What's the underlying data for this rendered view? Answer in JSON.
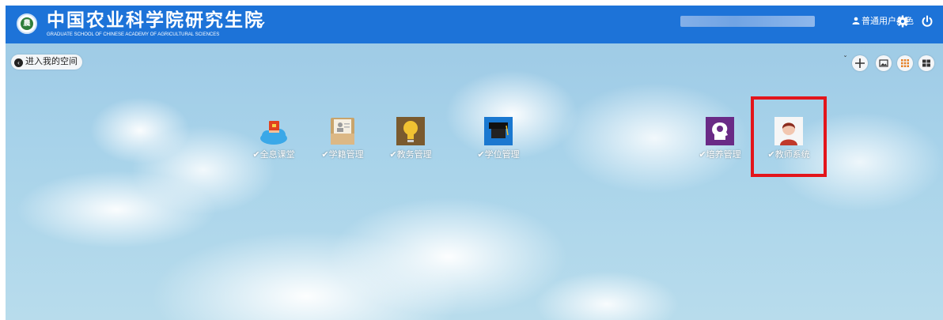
{
  "header": {
    "title_cn": "中国农业科学院研究生院",
    "title_en": "GRADUATE SCHOOL OF CHINESE ACADEMY OF AGRICULTURAL SCIENCES",
    "logo_text": "農",
    "role_label": "普通用户角色"
  },
  "toolbar": {
    "enter_space_label": "进入我的空间"
  },
  "apps": [
    {
      "label": "✔全息课堂",
      "icon": "cloud-book-icon"
    },
    {
      "label": "✔学籍管理",
      "icon": "file-folder-icon"
    },
    {
      "label": "✔教务管理",
      "icon": "lightbulb-icon"
    },
    {
      "label": "✔学位管理",
      "icon": "graduation-cap-icon"
    },
    {
      "label": "✔培养管理",
      "icon": "head-idea-icon"
    },
    {
      "label": "✔教师系统",
      "icon": "teacher-avatar-icon"
    }
  ],
  "colors": {
    "header_bg": "#1d73d8",
    "highlight": "#e3151b"
  }
}
